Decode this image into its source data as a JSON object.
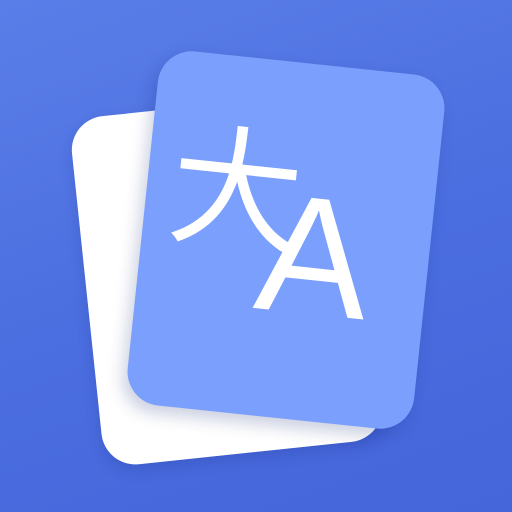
{
  "app_icon": {
    "glyph_source": "大",
    "glyph_target": "A"
  },
  "colors": {
    "background": "#4a6ddf",
    "back_card": "#ffffff",
    "front_card": "#7a9ffc",
    "glyph": "#ffffff"
  }
}
